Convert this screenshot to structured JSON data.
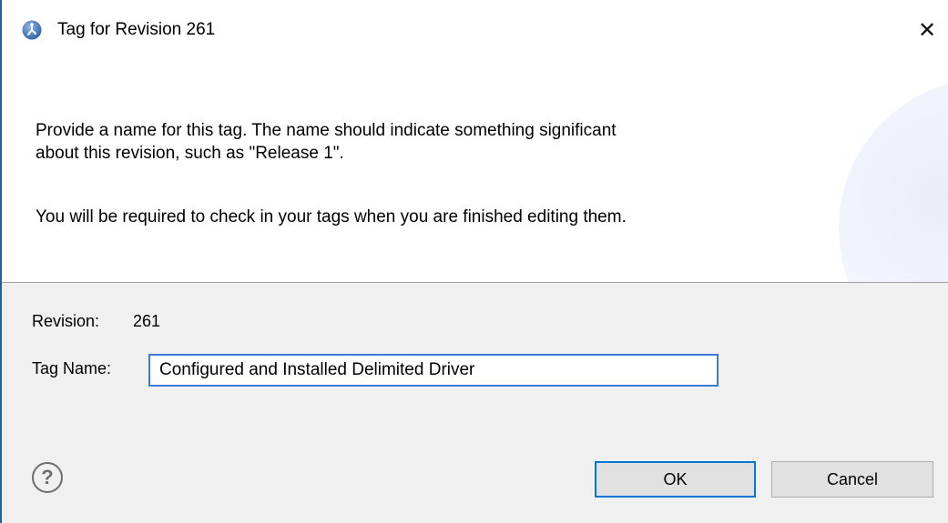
{
  "dialog": {
    "title": "Tag for Revision 261",
    "close_label": "✕"
  },
  "header": {
    "message_line1": "Provide a name for this tag.  The name should indicate something significant",
    "message_line2": "about this revision, such as \"Release 1\".",
    "message_line3": "You will be required to check in your tags when you are finished editing them."
  },
  "form": {
    "revision_label": "Revision:",
    "revision_value": "261",
    "tag_name_label": "Tag Name:",
    "tag_name_value": "Configured and Installed Delimited Driver"
  },
  "footer": {
    "help_label": "?",
    "ok_label": "OK",
    "cancel_label": "Cancel"
  },
  "colors": {
    "accent": "#0078d7",
    "input_focus_border": "#3a7cd5",
    "button_bg": "#e1e1e1",
    "dialog_bg": "#f0f0f0"
  },
  "icons": {
    "app": "eclipse-app-icon",
    "close": "close-icon",
    "help": "help-icon"
  }
}
